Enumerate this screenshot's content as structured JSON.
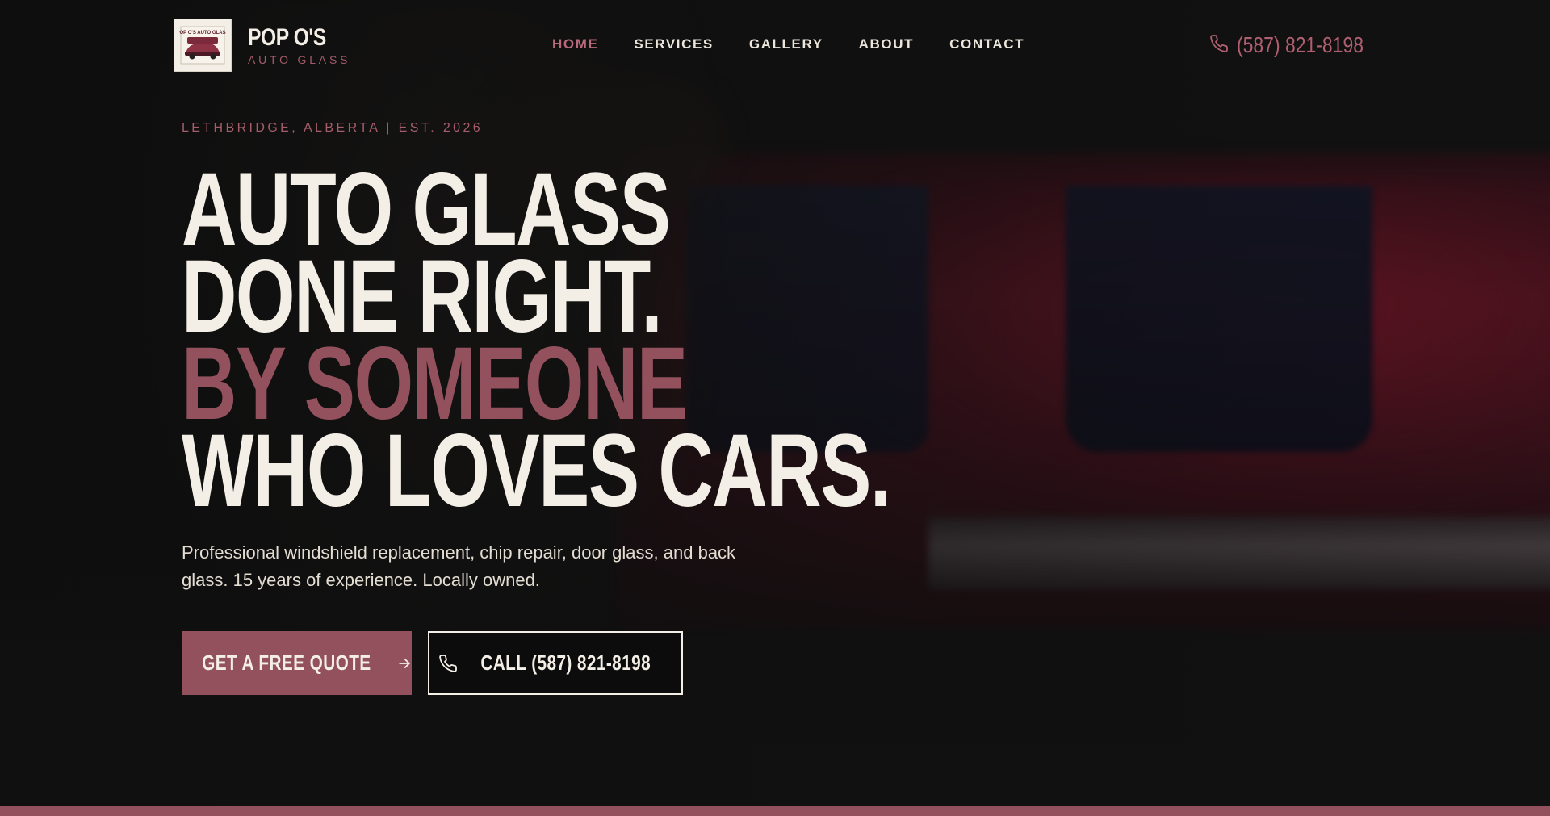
{
  "brand": {
    "name": "POP O'S",
    "subtitle": "AUTO GLASS",
    "logo_text": "POP O'S AUTO GLASS"
  },
  "nav": {
    "items": [
      {
        "label": "HOME",
        "active": true
      },
      {
        "label": "SERVICES",
        "active": false
      },
      {
        "label": "GALLERY",
        "active": false
      },
      {
        "label": "ABOUT",
        "active": false
      },
      {
        "label": "CONTACT",
        "active": false
      }
    ]
  },
  "header_phone": {
    "icon": "phone-icon",
    "label": "(587) 821-8198"
  },
  "hero": {
    "eyebrow": "LETHBRIDGE, ALBERTA | EST. 2026",
    "headline_lines": [
      "AUTO GLASS",
      "DONE RIGHT.",
      "BY SOMEONE",
      "WHO LOVES CARS."
    ],
    "subtext": "Professional windshield replacement, chip repair, door glass, and back glass. 15 years of experience. Locally owned.",
    "primary_cta": {
      "label": "GET A FREE QUOTE",
      "icon": "arrow-right-icon"
    },
    "secondary_cta": {
      "label": "CALL (587) 821-8198",
      "icon": "phone-icon"
    }
  },
  "colors": {
    "accent": "#93505d",
    "accent_light": "#b8697a",
    "text": "#f4efe6",
    "background": "#111111"
  }
}
